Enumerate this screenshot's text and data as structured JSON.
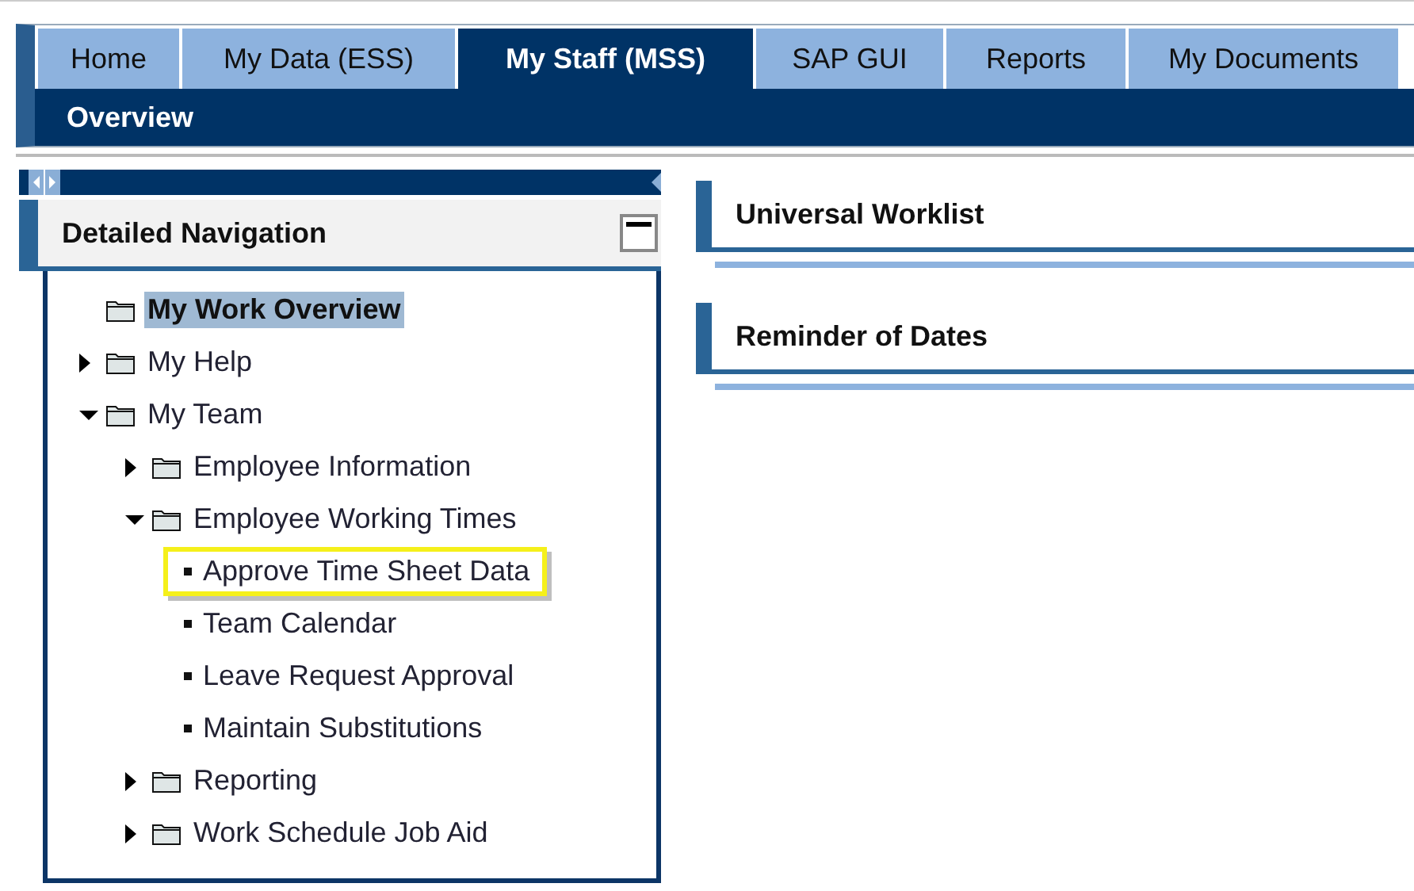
{
  "tabs": [
    {
      "label": "Home",
      "selected": false
    },
    {
      "label": "My Data (ESS)",
      "selected": false
    },
    {
      "label": "My Staff (MSS)",
      "selected": true
    },
    {
      "label": "SAP GUI",
      "selected": false
    },
    {
      "label": "Reports",
      "selected": false
    },
    {
      "label": "My Documents",
      "selected": false
    }
  ],
  "subnav": {
    "label": "Overview"
  },
  "navigation": {
    "title": "Detailed Navigation",
    "items": [
      {
        "label": "My Work Overview",
        "kind": "folder",
        "selected": true
      },
      {
        "label": "My Help",
        "kind": "folder",
        "selected": false,
        "expanded": false
      },
      {
        "label": "My Team",
        "kind": "folder",
        "selected": false,
        "expanded": true,
        "children": [
          {
            "label": "Employee Information",
            "kind": "folder",
            "selected": false,
            "expanded": false
          },
          {
            "label": "Employee Working Times",
            "kind": "folder",
            "selected": false,
            "expanded": true,
            "children": [
              {
                "label": "Approve Time Sheet Data",
                "kind": "leaf",
                "selected": false,
                "highlighted": true
              },
              {
                "label": "Team Calendar",
                "kind": "leaf",
                "selected": false,
                "highlighted": false
              },
              {
                "label": "Leave Request Approval",
                "kind": "leaf",
                "selected": false,
                "highlighted": false
              },
              {
                "label": "Maintain Substitutions",
                "kind": "leaf",
                "selected": false,
                "highlighted": false
              }
            ]
          },
          {
            "label": "Reporting",
            "kind": "folder",
            "selected": false,
            "expanded": false
          },
          {
            "label": "Work Schedule Job Aid",
            "kind": "folder",
            "selected": false,
            "expanded": false
          }
        ]
      }
    ]
  },
  "panels": [
    {
      "title": "Universal Worklist"
    },
    {
      "title": "Reminder of Dates"
    }
  ]
}
